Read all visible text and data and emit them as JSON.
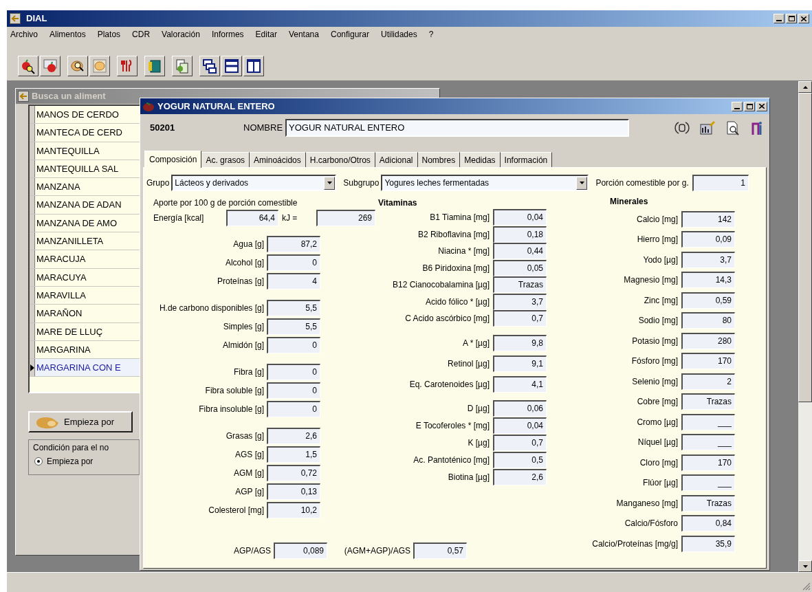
{
  "window": {
    "title": "DIAL"
  },
  "menu": [
    "Archivo",
    "Alimentos",
    "Platos",
    "CDR",
    "Valoración",
    "Informes",
    "Editar",
    "Ventana",
    "Configurar",
    "Utilidades",
    "?"
  ],
  "search_window": {
    "title": "Busca un aliment",
    "rows": [
      {
        "name": "MANOS DE CERDO",
        "selected": false
      },
      {
        "name": "MANTECA DE CERD",
        "selected": false
      },
      {
        "name": "MANTEQUILLA",
        "selected": false
      },
      {
        "name": "MANTEQUILLA SAL",
        "selected": false
      },
      {
        "name": "MANZANA",
        "selected": false
      },
      {
        "name": "MANZANA DE ADAN",
        "selected": false
      },
      {
        "name": "MANZANA DE AMO",
        "selected": false
      },
      {
        "name": "MANZANILLETA",
        "selected": false
      },
      {
        "name": "MARACUJA",
        "selected": false
      },
      {
        "name": "MARACUYA",
        "selected": false
      },
      {
        "name": "MARAVILLA",
        "selected": false
      },
      {
        "name": "MARAÑON",
        "selected": false
      },
      {
        "name": "MARE DE LLUÇ",
        "selected": false
      },
      {
        "name": "MARGARINA",
        "selected": false
      },
      {
        "name": "MARGARINA CON E",
        "selected": true
      }
    ],
    "search_button": "Empieza por",
    "condition": {
      "legend": "Condición para el no",
      "options": [
        {
          "label": "Empieza por",
          "selected": true
        }
      ]
    }
  },
  "food_window": {
    "title": "YOGUR NATURAL ENTERO",
    "code": "50201",
    "name_label": "NOMBRE",
    "name_value": "YOGUR NATURAL ENTERO",
    "tabs": [
      {
        "label": "Composición",
        "selected": true
      },
      {
        "label": "Ac. grasos",
        "selected": false
      },
      {
        "label": "Aminoácidos",
        "selected": false
      },
      {
        "label": "H.carbono/Otros",
        "selected": false
      },
      {
        "label": "Adicional",
        "selected": false
      },
      {
        "label": "Nombres",
        "selected": false
      },
      {
        "label": "Medidas",
        "selected": false
      },
      {
        "label": "Información",
        "selected": false
      }
    ],
    "group": {
      "label": "Grupo",
      "value": "Lácteos y derivados"
    },
    "subgroup": {
      "label": "Subgrupo",
      "value": "Yogures leches fermentadas"
    },
    "portion": {
      "label": "Porción comestible por g.",
      "value": "1"
    },
    "caption": "Aporte por 100 g de porción comestible",
    "energy": {
      "label": "Energía [kcal]",
      "value": "64,4",
      "kj_label": "kJ =",
      "kj_value": "269"
    },
    "macros": [
      [
        {
          "label": "Agua [g]",
          "value": "87,2"
        },
        {
          "label": "Alcohol [g]",
          "value": "0"
        },
        {
          "label": "Proteínas [g]",
          "value": "4"
        }
      ],
      [
        {
          "label": "H.de carbono disponibles [g]",
          "value": "5,5"
        },
        {
          "label": "Simples [g]",
          "value": "5,5"
        },
        {
          "label": "Almidón [g]",
          "value": "0"
        }
      ],
      [
        {
          "label": "Fibra [g]",
          "value": "0"
        },
        {
          "label": "Fibra soluble [g]",
          "value": "0"
        },
        {
          "label": "Fibra insoluble [g]",
          "value": "0"
        }
      ],
      [
        {
          "label": "Grasas [g]",
          "value": "2,6"
        },
        {
          "label": "AGS [g]",
          "value": "1,5"
        },
        {
          "label": "AGM [g]",
          "value": "0,72"
        },
        {
          "label": "AGP [g]",
          "value": "0,13"
        },
        {
          "label": "Colesterol [mg]",
          "value": "10,2"
        }
      ]
    ],
    "vitamins": {
      "heading": "Vitaminas",
      "groups": [
        [
          {
            "label": "B1 Tiamina [mg]",
            "value": "0,04"
          },
          {
            "label": "B2 Riboflavina [mg]",
            "value": "0,18"
          },
          {
            "label": "Niacina * [mg]",
            "value": "0,44"
          },
          {
            "label": "B6 Piridoxina [mg]",
            "value": "0,05"
          },
          {
            "label": "B12 Cianocobalamina [µg]",
            "value": "Trazas"
          },
          {
            "label": "Acido fólico * [µg]",
            "value": "3,7"
          },
          {
            "label": "C Acido ascórbico [mg]",
            "value": "0,7"
          }
        ],
        [
          {
            "label": "A * [µg]",
            "value": "9,8"
          },
          {
            "label": "Retinol [µg]",
            "value": "9,1"
          },
          {
            "label": "Eq. Carotenoides [µg]",
            "value": "4,1"
          }
        ],
        [
          {
            "label": "D [µg]",
            "value": "0,06"
          },
          {
            "label": "E Tocoferoles * [mg]",
            "value": "0,04"
          },
          {
            "label": "K [µg]",
            "value": "0,7"
          },
          {
            "label": "Ac. Pantoténico [mg]",
            "value": "0,5"
          },
          {
            "label": "Biotina [µg]",
            "value": "2,6"
          }
        ]
      ]
    },
    "minerals": {
      "heading": "Minerales",
      "rows": [
        {
          "label": "Calcio [mg]",
          "value": "142"
        },
        {
          "label": "Hierro [mg]",
          "value": "0,09"
        },
        {
          "label": "Yodo [µg]",
          "value": "3,7"
        },
        {
          "label": "Magnesio [mg]",
          "value": "14,3"
        },
        {
          "label": "Zinc [mg]",
          "value": "0,59"
        },
        {
          "label": "Sodio [mg]",
          "value": "80"
        },
        {
          "label": "Potasio [mg]",
          "value": "280"
        },
        {
          "label": "Fósforo [mg]",
          "value": "170"
        },
        {
          "label": "Selenio [mg]",
          "value": "2"
        },
        {
          "label": "Cobre [mg]",
          "value": "Trazas"
        },
        {
          "label": "Cromo [µg]",
          "value": "___"
        },
        {
          "label": "Níquel [µg]",
          "value": "___"
        },
        {
          "label": "Cloro [mg]",
          "value": "170"
        },
        {
          "label": "Flúor [µg]",
          "value": "___"
        },
        {
          "label": "Manganeso [mg]",
          "value": "Trazas"
        },
        {
          "label": "Calcio/Fósforo",
          "value": "0,84"
        },
        {
          "label": "Calcio/Proteínas [mg/g]",
          "value": "35,9"
        }
      ]
    },
    "ratios": [
      {
        "label": "AGP/AGS",
        "value": "0,089"
      },
      {
        "label": "(AGM+AGP)/AGS",
        "value": "0,57"
      }
    ]
  }
}
